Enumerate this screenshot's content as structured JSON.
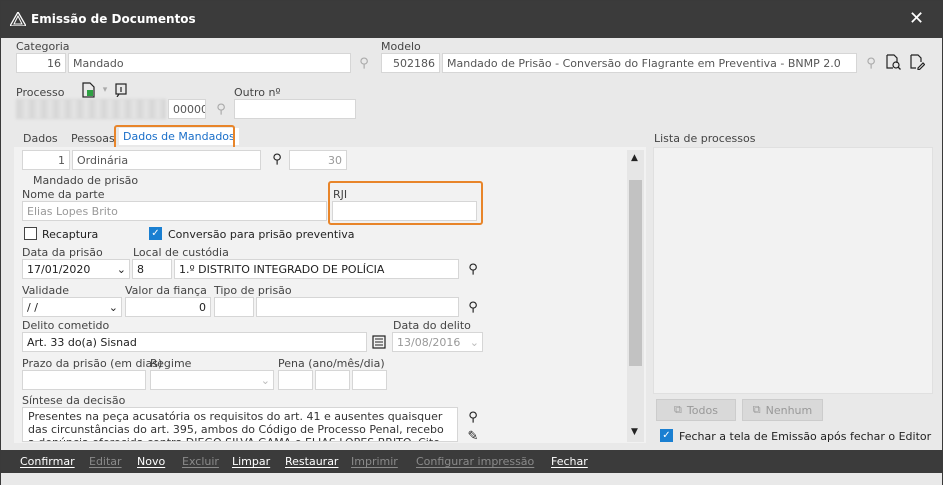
{
  "window": {
    "title": "Emissão de Documentos",
    "close_glyph": "✕"
  },
  "header": {
    "categoria_label": "Categoria",
    "categoria_code": "16",
    "categoria_value": "Mandado",
    "modelo_label": "Modelo",
    "modelo_code": "502186",
    "modelo_value": "Mandado de Prisão - Conversão do Flagrante em Preventiva - BNMP 2.0",
    "processo_label": "Processo",
    "processo_suffix": "00000",
    "outro_label": "Outro nº",
    "outro_value": ""
  },
  "tabs": [
    {
      "label": "Dados"
    },
    {
      "label": "Pessoas"
    },
    {
      "label": "Dados de Mandados"
    }
  ],
  "form": {
    "tipo_code": "1",
    "tipo_value": "Ordinária",
    "count_value": "30",
    "section_label": "Mandado de prisão",
    "nome_label": "Nome da parte",
    "nome_value": "Elias Lopes Brito",
    "rji_label": "RJI",
    "rji_value": "",
    "recaptura_label": "Recaptura",
    "conversao_label": "Conversão para prisão preventiva",
    "data_prisao_label": "Data da prisão",
    "data_prisao_value": "17/01/2020",
    "local_label": "Local de custódia",
    "local_code": "8",
    "local_value": "1.º DISTRITO INTEGRADO DE POLÍCIA",
    "validade_label": "Validade",
    "validade_value": " /  /",
    "fianca_label": "Valor da fiança",
    "fianca_value": "0",
    "tipo_prisao_label": "Tipo de prisão",
    "delito_label": "Delito cometido",
    "delito_value": "Art. 33 do(a) Sisnad",
    "data_delito_label": "Data do delito",
    "data_delito_value": "13/08/2016",
    "prazo_label": "Prazo da prisão (em dias)",
    "regime_label": "Regime",
    "pena_label": "Pena (ano/mês/dia)",
    "sintese_label": "Síntese da decisão",
    "sintese_text": "Presentes na peça acusatória os requisitos do art. 41 e ausentes quaisquer das circunstâncias do art. 395, ambos do Código de Processo Penal, recebo a denúncia oferecida contra DIEGO SILVA GAMA e ELIAS LOPES BRITO. Cite-se o acusado"
  },
  "right_panel": {
    "lista_label": "Lista de processos",
    "todos_label": "Todos",
    "nenhum_label": "Nenhum",
    "fechar_check_label": "Fechar a tela de Emissão após fechar o Editor"
  },
  "bottom_bar": {
    "confirmar": "Confirmar",
    "editar": "Editar",
    "novo": "Novo",
    "excluir": "Excluir",
    "limpar": "Limpar",
    "restaurar": "Restaurar",
    "imprimir": "Imprimir",
    "configurar": "Configurar impressão",
    "fechar": "Fechar"
  },
  "colors": {
    "accent": "#1a6fc9",
    "highlight": "#e8852a",
    "bar": "#3b3b3b"
  }
}
